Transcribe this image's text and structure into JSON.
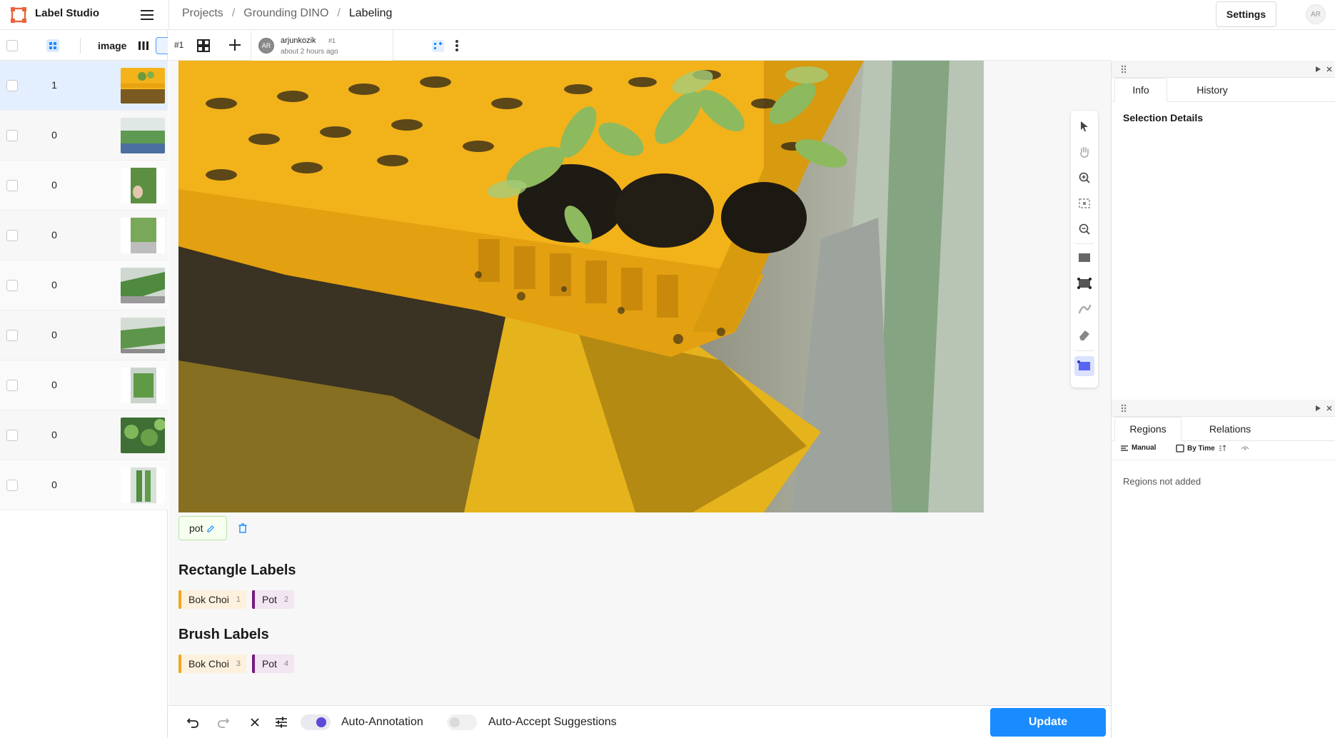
{
  "app": {
    "title": "Label Studio",
    "accent_color": "#1a8cff",
    "logo_color": "#e8643c"
  },
  "breadcrumb": {
    "items": [
      "Projects",
      "Grounding DINO",
      "Labeling"
    ],
    "separator": "/"
  },
  "header": {
    "settings_label": "Settings",
    "user_initials": "AR"
  },
  "task_list": {
    "column_label": "image",
    "rows": [
      {
        "count": "1",
        "selected": true,
        "thumb": "orange-tray"
      },
      {
        "count": "0",
        "selected": false,
        "thumb": "greenhouse-rows"
      },
      {
        "count": "0",
        "selected": false,
        "thumb": "hand-plant"
      },
      {
        "count": "0",
        "selected": false,
        "thumb": "plant-tray"
      },
      {
        "count": "0",
        "selected": false,
        "thumb": "greenhouse-bench"
      },
      {
        "count": "0",
        "selected": false,
        "thumb": "greenhouse-bench-2"
      },
      {
        "count": "0",
        "selected": false,
        "thumb": "vertical-farm"
      },
      {
        "count": "0",
        "selected": false,
        "thumb": "leafy-plants"
      },
      {
        "count": "0",
        "selected": false,
        "thumb": "vertical-tower"
      }
    ]
  },
  "annotation_bar": {
    "task_id": "#1",
    "user": "arjunkozik",
    "annotation_number": "#1",
    "time": "about 2 hours ago",
    "avatar_initials": "AR"
  },
  "region_chip": {
    "label": "pot"
  },
  "rectangle_labels": {
    "title": "Rectangle Labels",
    "items": [
      {
        "name": "Bok Choi",
        "hotkey": "1",
        "color": "#f5a623"
      },
      {
        "name": "Pot",
        "hotkey": "2",
        "color": "#7b1a7b"
      }
    ]
  },
  "brush_labels": {
    "title": "Brush Labels",
    "items": [
      {
        "name": "Bok Choi",
        "hotkey": "3",
        "color": "#f5a623"
      },
      {
        "name": "Pot",
        "hotkey": "4",
        "color": "#7b1a7b"
      }
    ]
  },
  "tools": [
    "pointer-tool",
    "pan-tool",
    "zoom-in-tool",
    "zoom-fit-tool",
    "zoom-out-tool",
    "rectangle-tool",
    "rectangle-3point-tool",
    "brush-tool",
    "eraser-tool",
    "smart-rectangle-tool"
  ],
  "bottom_bar": {
    "auto_annotation_label": "Auto-Annotation",
    "auto_annotation_on": true,
    "auto_accept_label": "Auto-Accept Suggestions",
    "auto_accept_on": false,
    "update_label": "Update"
  },
  "right_panel": {
    "info_tab": "Info",
    "history_tab": "History",
    "selection_details": "Selection Details",
    "regions_tab": "Regions",
    "relations_tab": "Relations",
    "sort_manual": "Manual",
    "sort_by_time": "By Time",
    "regions_empty": "Regions not added"
  }
}
